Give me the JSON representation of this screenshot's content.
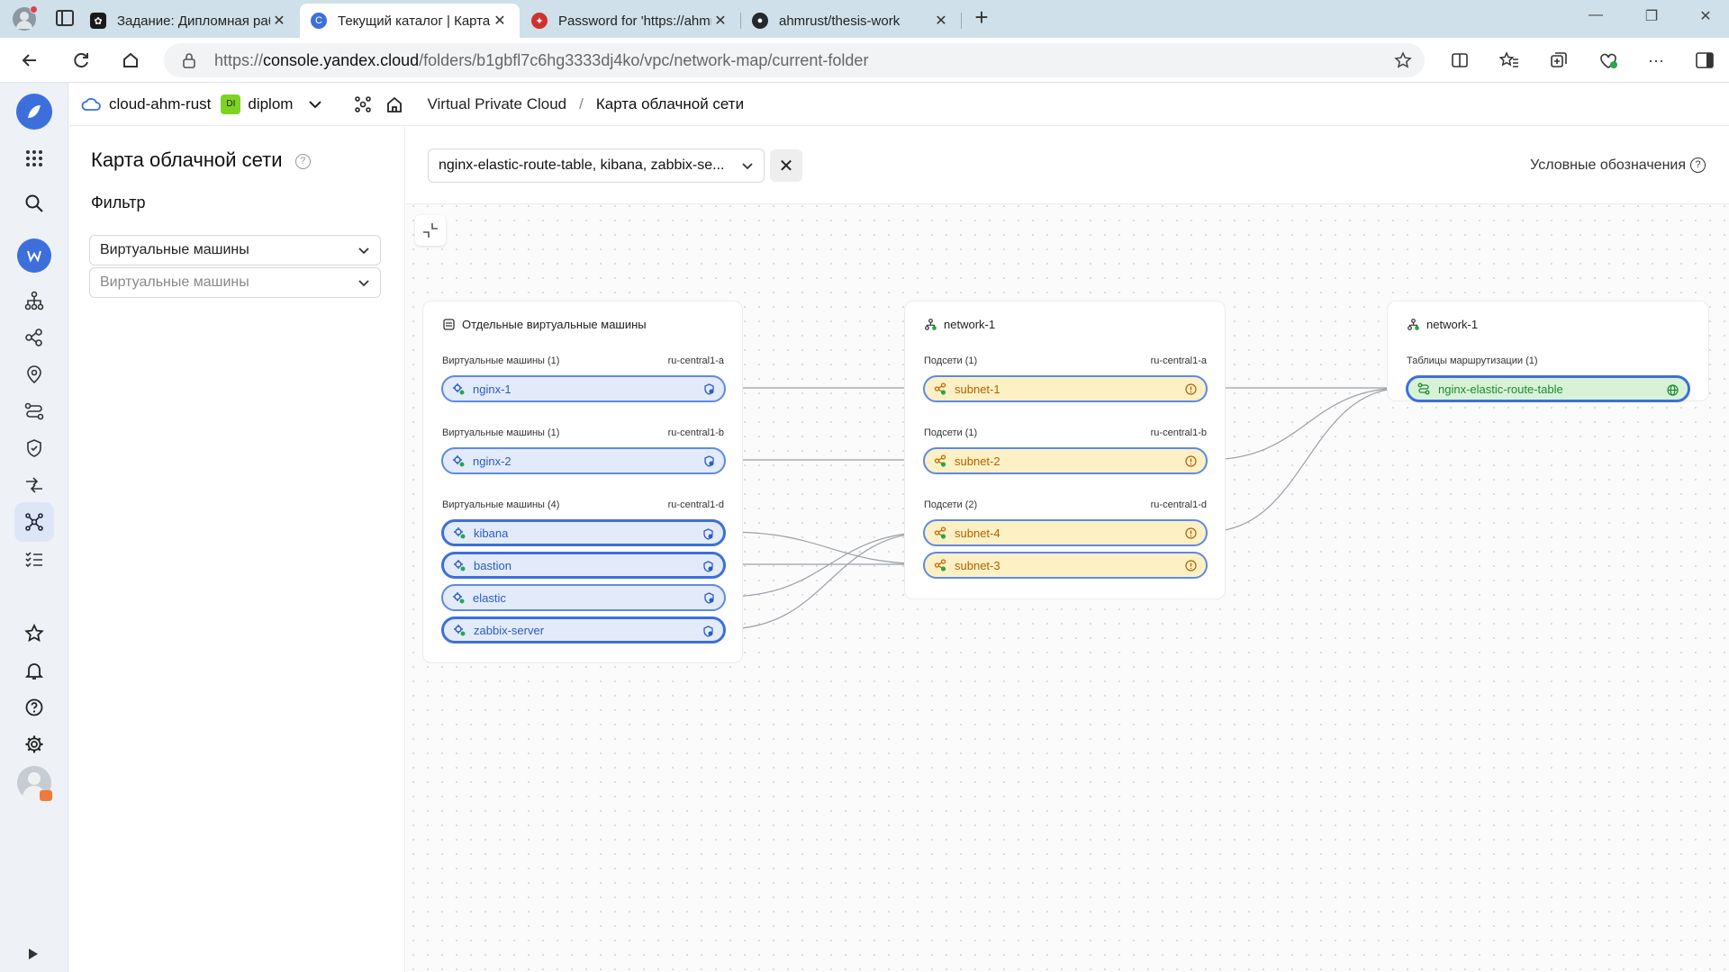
{
  "browser": {
    "tabs": [
      {
        "title": "Задание: Дипломная работа про",
        "close": "✕"
      },
      {
        "title": "Текущий каталог | Карта облачн",
        "close": "✕"
      },
      {
        "title": "Password for 'https://ahmrust@",
        "close": "✕"
      },
      {
        "title": "ahmrust/thesis-work",
        "close": "✕"
      }
    ],
    "new_tab": "+",
    "url_prefix": "https://",
    "url_domain": "console.yandex.cloud",
    "url_path": "/folders/b1gbfl7c6hg3333dj4ko/vpc/network-map/current-folder"
  },
  "header": {
    "cloud": "cloud-ahm-rust",
    "folder_badge": "DI",
    "folder": "diplom",
    "breadcrumb_service": "Virtual Private Cloud",
    "breadcrumb_sep": "/",
    "breadcrumb_page": "Карта облачной сети"
  },
  "filter_panel": {
    "title": "Карта облачной сети",
    "filter_label": "Фильтр",
    "select_type": "Виртуальные машины",
    "select_items_placeholder": "Виртуальные машины"
  },
  "map": {
    "selection": "nginx-elastic-route-table, kibana, zabbix-se...",
    "legend": "Условные обозначения",
    "groups": [
      {
        "title": "Отдельные виртуальные машины",
        "sections": [
          {
            "label": "Виртуальные машины (1)",
            "zone": "ru-central1-a",
            "nodes": [
              "nginx-1"
            ]
          },
          {
            "label": "Виртуальные машины (1)",
            "zone": "ru-central1-b",
            "nodes": [
              "nginx-2"
            ]
          },
          {
            "label": "Виртуальные машины (4)",
            "zone": "ru-central1-d",
            "nodes": [
              "kibana",
              "bastion",
              "elastic",
              "zabbix-server"
            ]
          }
        ]
      },
      {
        "title": "network-1",
        "sections": [
          {
            "label": "Подсети (1)",
            "zone": "ru-central1-a",
            "nodes": [
              "subnet-1"
            ]
          },
          {
            "label": "Подсети (1)",
            "zone": "ru-central1-b",
            "nodes": [
              "subnet-2"
            ]
          },
          {
            "label": "Подсети (2)",
            "zone": "ru-central1-d",
            "nodes": [
              "subnet-4",
              "subnet-3"
            ]
          }
        ]
      },
      {
        "title": "network-1",
        "sections": [
          {
            "label": "Таблицы маршрутизации (1)",
            "nodes": [
              "nginx-elastic-route-table"
            ]
          }
        ]
      }
    ]
  },
  "colors": {
    "accent": "#3d6fdc",
    "vm_fill": "#e3ebfb",
    "subnet_fill": "#fdf0c4",
    "route_fill": "#d8f2d8",
    "folder_badge": "#7ed321"
  }
}
